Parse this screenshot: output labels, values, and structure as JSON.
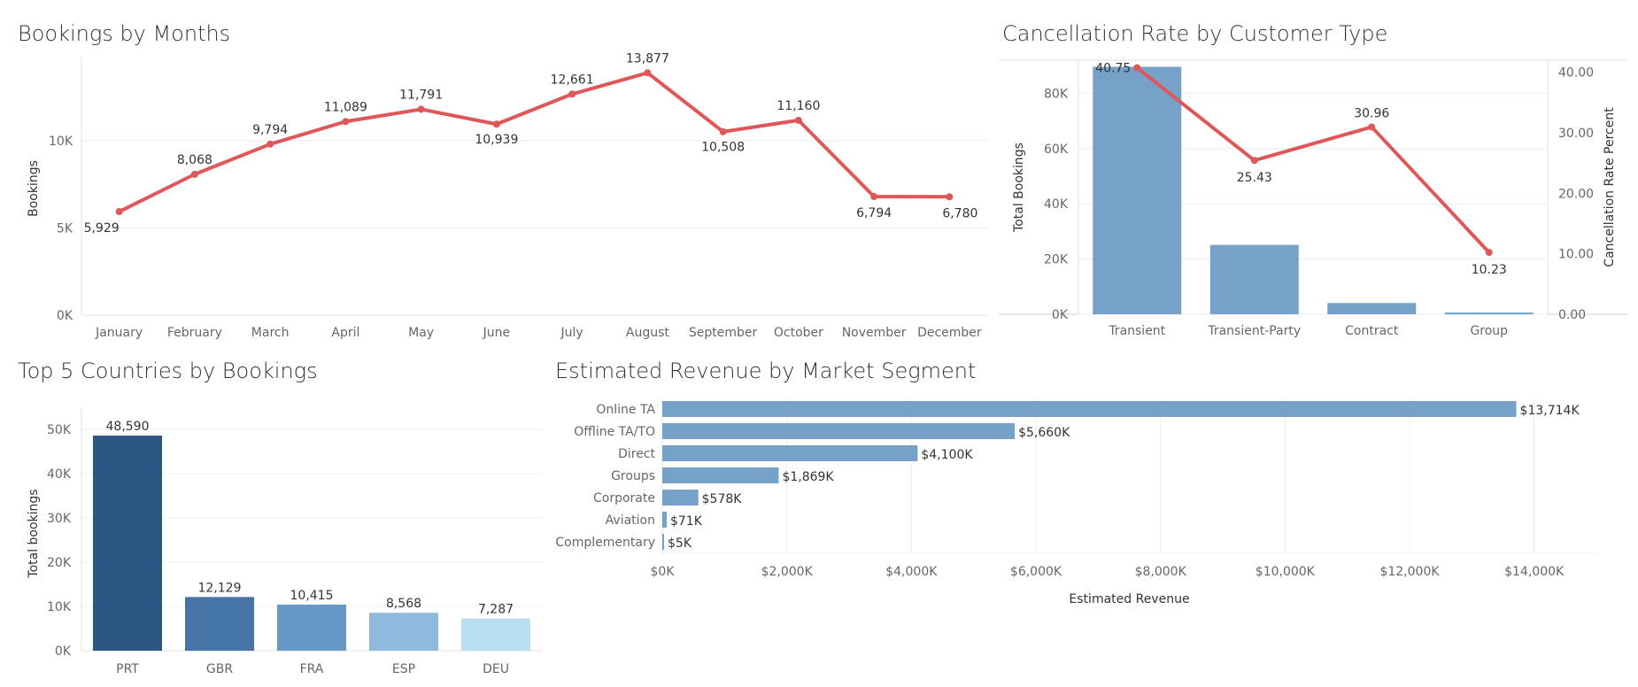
{
  "chart_data": [
    {
      "type": "line",
      "title": "Bookings by Months",
      "xlabel": "",
      "ylabel": "Bookings",
      "categories": [
        "January",
        "February",
        "March",
        "April",
        "May",
        "June",
        "July",
        "August",
        "September",
        "October",
        "November",
        "December"
      ],
      "values": [
        5929,
        8068,
        9794,
        11089,
        11791,
        10939,
        12661,
        13877,
        10508,
        11160,
        6794,
        6780
      ],
      "data_labels": [
        "5,929",
        "8,068",
        "9,794",
        "11,089",
        "11,791",
        "10,939",
        "12,661",
        "13,877",
        "10,508",
        "11,160",
        "6,794",
        "6,780"
      ],
      "yticks": [
        0,
        5000,
        10000
      ],
      "ytick_labels": [
        "0K",
        "5K",
        "10K"
      ],
      "ylim": [
        0,
        14500
      ],
      "color": "#e05759",
      "grid": true
    },
    {
      "type": "bar+line",
      "title": "Cancellation Rate by Customer Type",
      "ylabel": "Total Bookings",
      "y2label": "Cancellation Rate Percent",
      "categories": [
        "Transient",
        "Transient-Party",
        "Contract",
        "Group"
      ],
      "bar_values": [
        89613,
        25124,
        4076,
        577
      ],
      "line_values": [
        40.75,
        25.43,
        30.96,
        10.23
      ],
      "line_labels": [
        "40.75",
        "25.43",
        "30.96",
        "10.23"
      ],
      "yticks": [
        0,
        20000,
        40000,
        60000,
        80000
      ],
      "ytick_labels": [
        "0K",
        "20K",
        "40K",
        "60K",
        "80K"
      ],
      "ylim": [
        0,
        92000
      ],
      "y2ticks": [
        0,
        10,
        20,
        30,
        40
      ],
      "y2tick_labels": [
        "0.00",
        "10.00",
        "20.00",
        "30.00",
        "40.00"
      ],
      "y2lim": [
        0,
        42
      ],
      "bar_color": "#76a1c8",
      "line_color": "#e05759",
      "grid": true
    },
    {
      "type": "bar",
      "title": "Top 5 Countries by Bookings",
      "ylabel": "Total bookings",
      "categories": [
        "PRT",
        "GBR",
        "FRA",
        "ESP",
        "DEU"
      ],
      "values": [
        48590,
        12129,
        10415,
        8568,
        7287
      ],
      "data_labels": [
        "48,590",
        "12,129",
        "10,415",
        "8,568",
        "7,287"
      ],
      "colors": [
        "#2c5784",
        "#4574a6",
        "#6799c6",
        "#8fbadd",
        "#b9def2"
      ],
      "yticks": [
        0,
        10000,
        20000,
        30000,
        40000,
        50000
      ],
      "ytick_labels": [
        "0K",
        "10K",
        "20K",
        "30K",
        "40K",
        "50K"
      ],
      "ylim": [
        0,
        53000
      ],
      "grid": true
    },
    {
      "type": "bar",
      "orientation": "horizontal",
      "title": "Estimated Revenue by Market Segment",
      "xlabel": "Estimated Revenue",
      "categories": [
        "Online TA",
        "Offline TA/TO",
        "Direct",
        "Groups",
        "Corporate",
        "Aviation",
        "Complementary"
      ],
      "values": [
        13714,
        5660,
        4100,
        1869,
        578,
        71,
        5
      ],
      "data_labels": [
        "$13,714K",
        "$5,660K",
        "$4,100K",
        "$1,869K",
        "$578K",
        "$71K",
        "$5K"
      ],
      "xticks": [
        0,
        2000,
        4000,
        6000,
        8000,
        10000,
        12000,
        14000
      ],
      "xtick_labels": [
        "$0K",
        "$2,000K",
        "$4,000K",
        "$6,000K",
        "$8,000K",
        "$10,000K",
        "$12,000K",
        "$14,000K"
      ],
      "xlim": [
        0,
        15000
      ],
      "color": "#76a1c8",
      "grid": true
    }
  ]
}
